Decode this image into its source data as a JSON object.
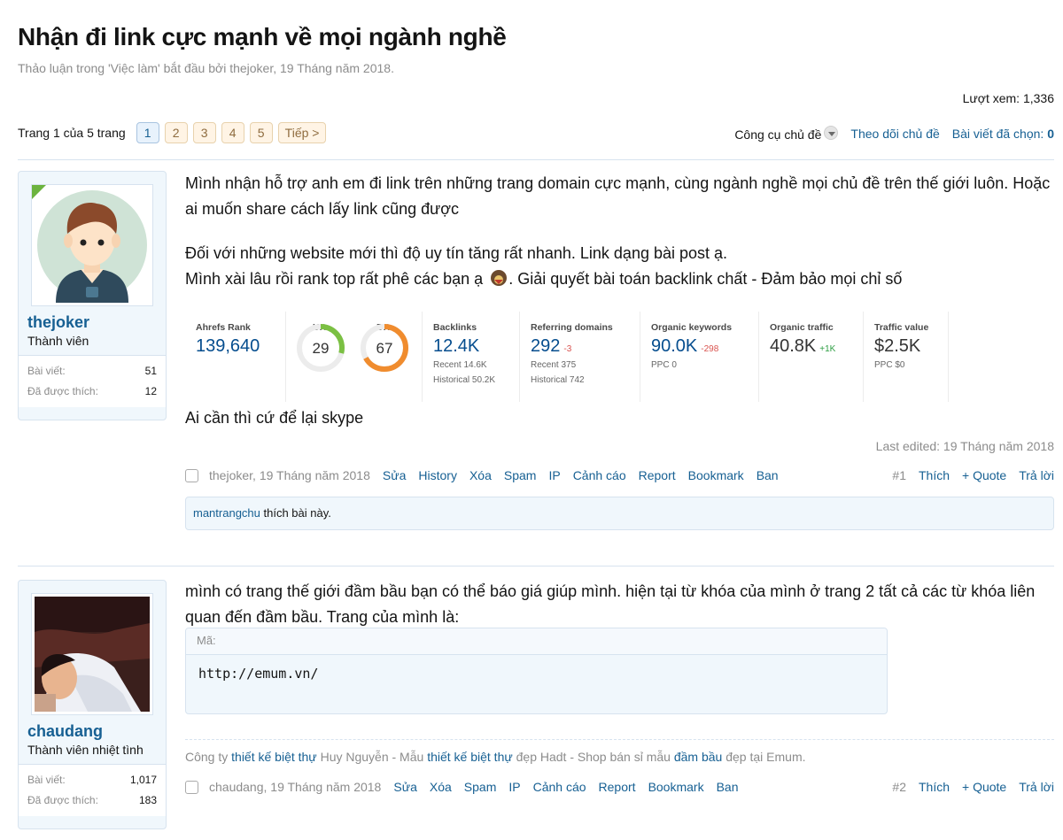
{
  "thread": {
    "title": "Nhận đi link cực mạnh về mọi ngành nghề",
    "meta": "Thảo luận trong 'Việc làm' bắt đầu bởi thejoker, 19 Tháng năm 2018.",
    "views": "Lượt xem: 1,336"
  },
  "pager": {
    "label": "Trang 1 của 5 trang",
    "pages": [
      "1",
      "2",
      "3",
      "4",
      "5"
    ],
    "next": "Tiếp >"
  },
  "tools": {
    "thread_tools": "Công cụ chủ đề",
    "watch": "Theo dõi chủ đề",
    "selected_label": "Bài viết đã chọn:",
    "selected_count": "0"
  },
  "posts": [
    {
      "user": {
        "name": "thejoker",
        "title": "Thành viên",
        "posts_label": "Bài viết:",
        "posts": "51",
        "likes_label": "Đã được thích:",
        "likes": "12"
      },
      "lines": [
        "Mình nhận hỗ trợ anh em đi link trên những trang domain cực mạnh, cùng ngành nghề mọi chủ đề trên thế giới luôn. Hoặc ai muốn share cách lấy link cũng được",
        "Đối với những website mới thì độ uy tín tăng rất nhanh. Link dạng bài post ạ.",
        "Mình xài lâu rồi rank top rất phê các bạn ạ",
        ". Giải quyết bài toán backlink chất - Đảm bảo mọi chỉ số",
        "Ai cần thì cứ để lại skype"
      ],
      "seo_stats": {
        "ahrefs_rank": {
          "label": "Ahrefs Rank",
          "value": "139,640"
        },
        "ur": {
          "label": "UR",
          "value": "29",
          "percent": 29,
          "color": "#7bc043"
        },
        "dr": {
          "label": "DR",
          "value": "67",
          "percent": 67,
          "color": "#f08c2e"
        },
        "backlinks": {
          "label": "Backlinks",
          "value": "12.4K",
          "recent": "Recent 14.6K",
          "historical": "Historical 50.2K"
        },
        "referring_domains": {
          "label": "Referring domains",
          "value": "292",
          "delta": "-3",
          "recent": "Recent 375",
          "historical": "Historical 742"
        },
        "organic_keywords": {
          "label": "Organic keywords",
          "value": "90.0K",
          "delta": "-298",
          "ppc": "PPC 0"
        },
        "organic_traffic": {
          "label": "Organic traffic",
          "value": "40.8K",
          "delta": "+1K"
        },
        "traffic_value": {
          "label": "Traffic value",
          "value": "$2.5K",
          "ppc": "PPC $0"
        }
      },
      "last_edited": "Last edited: 19 Tháng năm 2018",
      "footer": {
        "author": "thejoker, 19 Tháng năm 2018",
        "actions": [
          "Sửa",
          "History",
          "Xóa",
          "Spam",
          "IP",
          "Cảnh cáo",
          "Report",
          "Bookmark",
          "Ban"
        ],
        "number": "#1",
        "like": "Thích",
        "quote": "+ Quote",
        "reply": "Trả lời"
      },
      "liked_by": "mantrangchu",
      "liked_text": "thích bài này."
    },
    {
      "user": {
        "name": "chaudang",
        "title": "Thành viên nhiệt tình",
        "posts_label": "Bài viết:",
        "posts": "1,017",
        "likes_label": "Đã được thích:",
        "likes": "183"
      },
      "text": "mình có trang thế giới đầm bầu bạn có thể báo giá giúp mình. hiện tại từ khóa của mình ở trang 2 tất cả các từ khóa liên quan đến đầm bầu. Trang của mình là:",
      "code": {
        "label": "Mã:",
        "content": "http://emum.vn/"
      },
      "signature": {
        "p1": "Công ty",
        "l1": "thiết kế biệt thự",
        "p2": "Huy Nguyễn - Mẫu",
        "l2": "thiết kế biệt thự",
        "p3": "đẹp Hadt - Shop bán sỉ mẫu",
        "l3": "đầm bầu",
        "p4": "đẹp tại Emum."
      },
      "footer": {
        "author": "chaudang, 19 Tháng năm 2018",
        "actions": [
          "Sửa",
          "Xóa",
          "Spam",
          "IP",
          "Cảnh cáo",
          "Report",
          "Bookmark",
          "Ban"
        ],
        "number": "#2",
        "like": "Thích",
        "quote": "+ Quote",
        "reply": "Trả lời"
      }
    }
  ]
}
